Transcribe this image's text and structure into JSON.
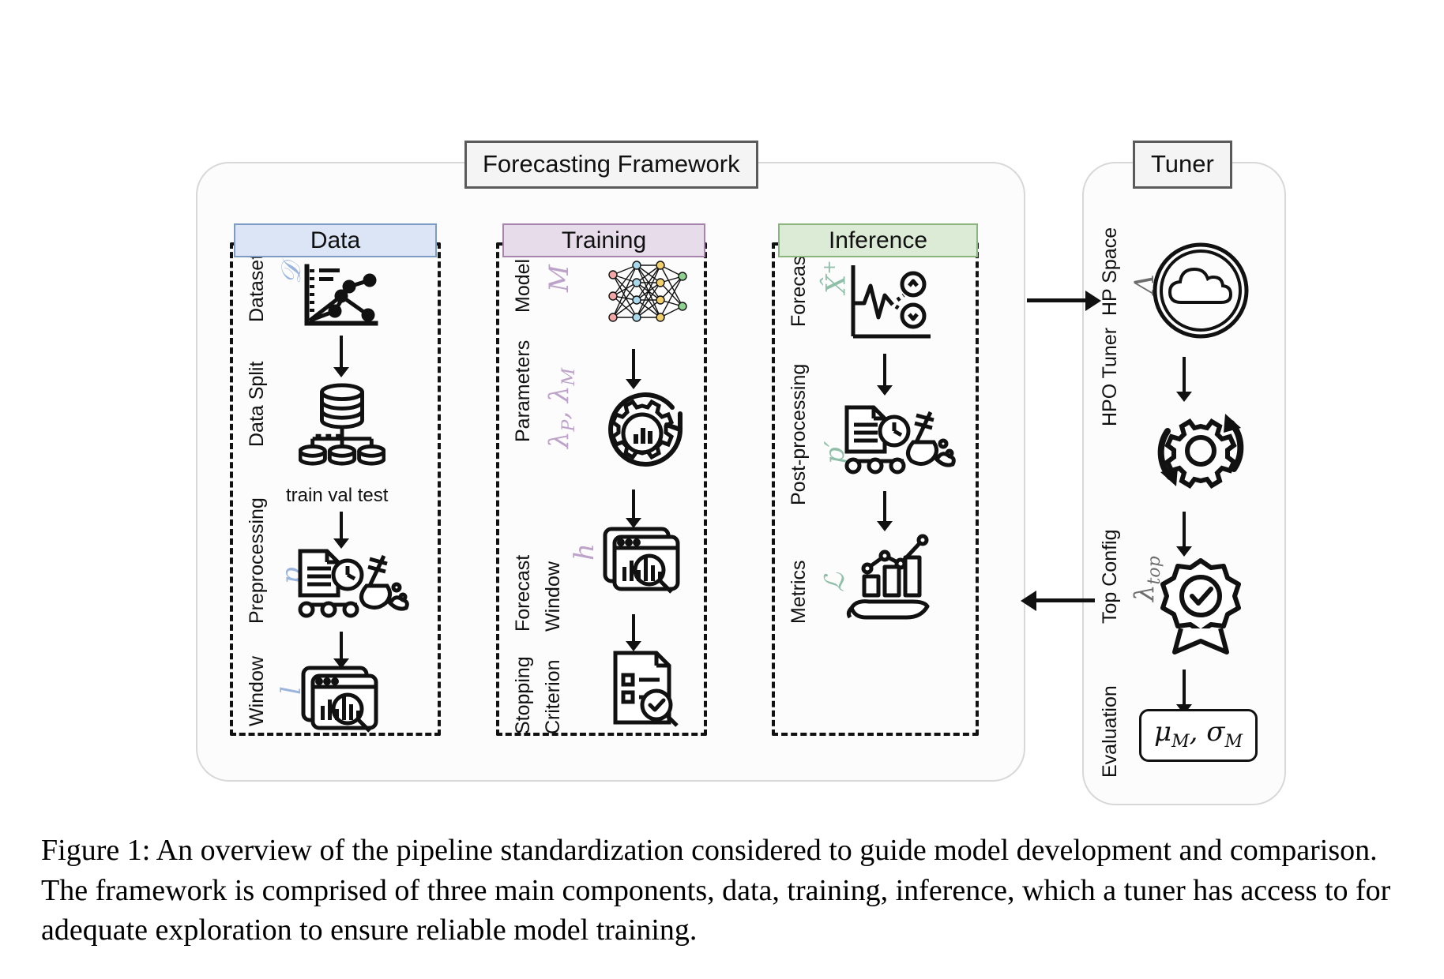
{
  "figure": {
    "framework_title": "Forecasting Framework",
    "tuner_title": "Tuner",
    "caption": "Figure 1: An overview of the pipeline standardization considered to guide model development and comparison. The framework is comprised of three main components, data, training, inference, which a tuner has access to for adequate exploration to ensure reliable model training."
  },
  "colors": {
    "data_fill": "#dbe5f5",
    "data_border": "#7e9bc4",
    "data_symbol": "#9bb4de",
    "training_fill": "#e7dcea",
    "training_border": "#a684ab",
    "training_symbol": "#bda2ca",
    "inference_fill": "#dcebd6",
    "inference_border": "#8cb57d",
    "inference_symbol": "#8fbfa8",
    "tuner_symbol": "#6d6d6d",
    "outline": "#111111",
    "panel_border": "#d8d8d8"
  },
  "stages": {
    "data": {
      "header": "Data",
      "steps": [
        {
          "label": "Dataset",
          "symbol": "ᴰ",
          "icon": "scatter-chart-icon"
        },
        {
          "label": "Data Split",
          "symbol": "",
          "icon": "database-split-icon"
        },
        {
          "label": "Preprocessing",
          "symbol": "p",
          "icon": "data-cleaning-icon"
        },
        {
          "label": "Window",
          "symbol": "l",
          "icon": "window-search-icon"
        }
      ],
      "split_caption": "train val test"
    },
    "training": {
      "header": "Training",
      "steps": [
        {
          "label": "Model",
          "symbol": "M",
          "icon": "neural-network-icon"
        },
        {
          "label": "Parameters",
          "symbol": "λₚ, λₘ",
          "icon": "gear-settings-icon"
        },
        {
          "label": "Forecast Window",
          "symbol": "h",
          "icon": "window-search-icon"
        },
        {
          "label": "Stopping Criterion",
          "symbol": "",
          "icon": "document-check-icon"
        }
      ]
    },
    "inference": {
      "header": "Inference",
      "steps": [
        {
          "label": "Forecast",
          "symbol": "X̂⁺",
          "icon": "forecast-signal-icon"
        },
        {
          "label": "Post-processing",
          "symbol": "p′",
          "icon": "data-cleaning-icon"
        },
        {
          "label": "Metrics",
          "symbol": "ℒ",
          "icon": "metrics-hand-icon"
        }
      ]
    },
    "tuner": {
      "steps": [
        {
          "label": "HP Space",
          "symbol": "Λ",
          "icon": "cloud-space-icon"
        },
        {
          "label": "HPO Tuner",
          "symbol": "",
          "icon": "gear-cycle-icon"
        },
        {
          "label": "Top Config",
          "symbol": "λₜₒₚ",
          "icon": "badge-check-icon"
        },
        {
          "label": "Evaluation",
          "symbol": "",
          "icon": "result-pill"
        }
      ],
      "result": "μₘ, σₘ"
    }
  },
  "symbols": {
    "dataset": "𝒟",
    "preprocessing": "p",
    "window": "l",
    "model": "M",
    "parameters": "λ",
    "parameters_sub_p": "P",
    "parameters_sub_m": "M",
    "forecast_window": "h",
    "forecast": "X",
    "postprocessing": "p",
    "metrics": "ℒ",
    "hp_space": "Λ",
    "top_config": "λ",
    "top_config_sub": "top",
    "result_mu": "μ",
    "result_sigma": "σ",
    "result_sub": "M"
  }
}
